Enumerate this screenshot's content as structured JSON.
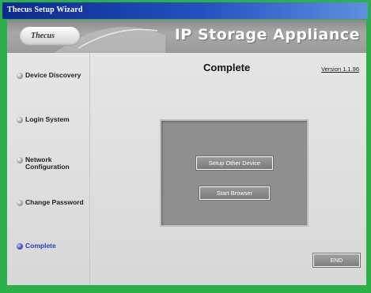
{
  "window": {
    "title": "Thecus Setup Wizard"
  },
  "banner": {
    "logo_text": "Thecus",
    "product_title": "IP Storage Appliance"
  },
  "header": {
    "page_title": "Complete",
    "version": "Version 1.1.96"
  },
  "sidebar": {
    "items": [
      {
        "label": "Device Discovery",
        "active": false
      },
      {
        "label": "Login System",
        "active": false
      },
      {
        "label": "Network Configuration",
        "active": false
      },
      {
        "label": "Change Password",
        "active": false
      },
      {
        "label": "Complete",
        "active": true
      }
    ]
  },
  "panel": {
    "setup_other_label": "Setup Other Device",
    "start_browser_label": "Start Browser"
  },
  "footer": {
    "end_label": "END"
  },
  "colors": {
    "frame": "#2cb04a",
    "titlebar": "#0b2a8e",
    "active_step": "#2a3fb6",
    "panel": "#8f8f8f"
  }
}
